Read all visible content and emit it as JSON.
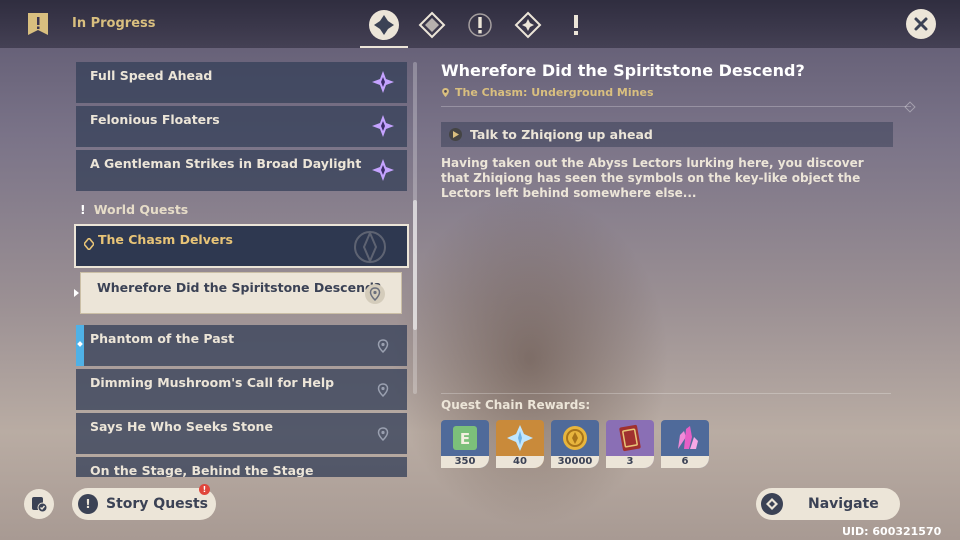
{
  "header": {
    "title": "In Progress"
  },
  "tabs": [
    {
      "name": "all-quests-tab",
      "active": true
    },
    {
      "name": "archon-quests-tab",
      "active": false
    },
    {
      "name": "story-quests-tab",
      "active": false
    },
    {
      "name": "commission-quests-tab",
      "active": false
    },
    {
      "name": "world-quests-tab",
      "active": false
    }
  ],
  "quest_list": {
    "archon_items": [
      {
        "label": "Full Speed Ahead"
      },
      {
        "label": "Felonious Floaters"
      },
      {
        "label": "A Gentleman Strikes in Broad Daylight"
      }
    ],
    "section_label": "World Quests",
    "chain_title": "The Chasm Delvers",
    "selected_quest": "Wherefore Did the Spiritstone Descend?",
    "world_items": [
      {
        "label": "Phantom of the Past"
      },
      {
        "label": "Dimming Mushroom's Call for Help"
      },
      {
        "label": "Says He Who Seeks Stone"
      },
      {
        "label": "On the Stage, Behind the Stage"
      }
    ]
  },
  "detail": {
    "title": "Wherefore Did the Spiritstone Descend?",
    "location": "The Chasm: Underground Mines",
    "objective": "Talk to Zhiqiong up ahead",
    "description": "Having taken out the Abyss Lectors lurking here, you discover that Zhiqiong has seen the symbols on the key-like object the Lectors left behind somewhere else..."
  },
  "rewards": {
    "label": "Quest Chain Rewards:",
    "items": [
      {
        "icon": "adventure-exp-icon",
        "qty": "350",
        "bg": "#4f6a9a"
      },
      {
        "icon": "primogem-icon",
        "qty": "40",
        "bg": "#c98a3a"
      },
      {
        "icon": "mora-icon",
        "qty": "30000",
        "bg": "#4f6a9a"
      },
      {
        "icon": "heros-wit-icon",
        "qty": "3",
        "bg": "#8a6fb5"
      },
      {
        "icon": "crystal-chunk-icon",
        "qty": "6",
        "bg": "#4f6a9a"
      }
    ]
  },
  "footer": {
    "story_quests_label": "Story Quests",
    "story_badge": "!",
    "navigate_label": "Navigate",
    "uid": "UID: 600321570"
  },
  "colors": {
    "accent_gold": "#d9bf7f",
    "panel": "#37415a",
    "cream": "#ece5d8",
    "tracked": "#4fb1e6"
  }
}
